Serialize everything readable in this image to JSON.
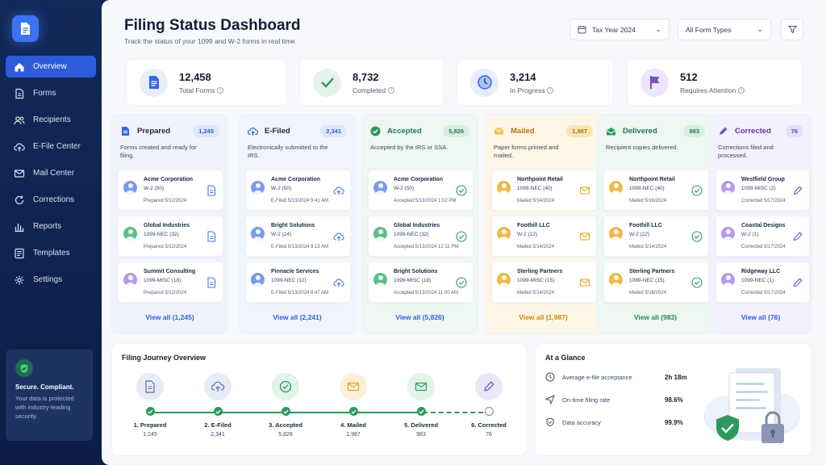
{
  "nav": {
    "items": [
      {
        "label": "Overview",
        "icon": "home-icon"
      },
      {
        "label": "Forms",
        "icon": "document-icon"
      },
      {
        "label": "Recipients",
        "icon": "users-icon"
      },
      {
        "label": "E-File Center",
        "icon": "cloud-upload-icon"
      },
      {
        "label": "Mail Center",
        "icon": "mail-icon"
      },
      {
        "label": "Corrections",
        "icon": "refresh-icon"
      },
      {
        "label": "Reports",
        "icon": "bar-chart-icon"
      },
      {
        "label": "Templates",
        "icon": "template-icon"
      },
      {
        "label": "Settings",
        "icon": "gear-icon"
      }
    ]
  },
  "secure": {
    "title": "Secure. Compliant.",
    "text": "Your data is protected with industry-leading security."
  },
  "header": {
    "title": "Filing Status Dashboard",
    "subtitle": "Track the status of your 1099 and W-2 forms in real time.",
    "tax_year": "Tax Year 2024",
    "form_types": "All Form Types"
  },
  "summary": [
    {
      "value": "12,458",
      "label": "Total Forms"
    },
    {
      "value": "8,732",
      "label": "Completed"
    },
    {
      "value": "3,214",
      "label": "In Progress"
    },
    {
      "value": "512",
      "label": "Requires Attention"
    }
  ],
  "columns": [
    {
      "title": "Prepared",
      "count": "1,245",
      "desc": "Forms created and ready for filing.",
      "view_all": "View all (1,245)",
      "accent": "#2f5fd8",
      "cards": [
        {
          "name": "Acme Corporation",
          "form": "W-2 (50)",
          "date": "Prepared 5/12/2024"
        },
        {
          "name": "Global Industries",
          "form": "1099-NEC (32)",
          "date": "Prepared 5/12/2024"
        },
        {
          "name": "Summit Consulting",
          "form": "1099-MISC (18)",
          "date": "Prepared 5/12/2024"
        }
      ]
    },
    {
      "title": "E-Filed",
      "count": "2,341",
      "desc": "Electronically submitted to the IRS.",
      "view_all": "View all (2,241)",
      "accent": "#2f5fd8",
      "cards": [
        {
          "name": "Acme Corporation",
          "form": "W-2 (50)",
          "date": "E-Filed 5/13/2024 9:41 AM"
        },
        {
          "name": "Bright Solutions",
          "form": "W-2 (24)",
          "date": "E-Filed 5/13/2024 9:15 AM"
        },
        {
          "name": "Pinnacle Services",
          "form": "1099-NEC (12)",
          "date": "E-Filed 5/13/2024 8:47 AM"
        }
      ]
    },
    {
      "title": "Accepted",
      "count": "5,826",
      "desc": "Accepted by the IRS or SSA.",
      "view_all": "View all (5,826)",
      "accent": "#27935a",
      "cards": [
        {
          "name": "Acme Corporation",
          "form": "W-2 (50)",
          "date": "Accepted 5/13/2024 1:02 PM"
        },
        {
          "name": "Global Industries",
          "form": "1099-NEC (32)",
          "date": "Accepted 5/13/2024 12:11 PM"
        },
        {
          "name": "Bright Solutions",
          "form": "1099-MISC (18)",
          "date": "Accepted 5/13/2024 11:00 AM"
        }
      ]
    },
    {
      "title": "Mailed",
      "count": "1,987",
      "desc": "Paper forms printed and mailed.",
      "view_all": "View all (1,987)",
      "accent": "#c98a0c",
      "cards": [
        {
          "name": "Northpoint Retail",
          "form": "1099-NEC (40)",
          "date": "Mailed 5/14/2024"
        },
        {
          "name": "Foothill LLC",
          "form": "W-2 (22)",
          "date": "Mailed 5/14/2024"
        },
        {
          "name": "Sterling Partners",
          "form": "1099-MISC (15)",
          "date": "Mailed 5/14/2024"
        }
      ]
    },
    {
      "title": "Delivered",
      "count": "983",
      "desc": "Recipient copies delivered.",
      "view_all": "View all (983)",
      "accent": "#1f8a58",
      "cards": [
        {
          "name": "Northpoint Retail",
          "form": "1099-NEC (40)",
          "date": "Mailed 5/16/2024"
        },
        {
          "name": "Foothill LLC",
          "form": "W-2 (22)",
          "date": "Mailed 5/14/2024"
        },
        {
          "name": "Sterling Partners",
          "form": "1099-NEC (15)",
          "date": "Mailed 5/16/2024"
        }
      ]
    },
    {
      "title": "Corrected",
      "count": "76",
      "desc": "Corrections filed and processed.",
      "view_all": "View all (76)",
      "accent": "#7b4fc9",
      "cards": [
        {
          "name": "Westfield Group",
          "form": "1099-MISC (2)",
          "date": "Corrected 5/17/2024"
        },
        {
          "name": "Coastal Designs",
          "form": "W-2 (1)",
          "date": "Corrected 5/17/2024"
        },
        {
          "name": "Ridgeway LLC",
          "form": "1099-NEC (1)",
          "date": "Corrected 5/17/2024"
        }
      ]
    }
  ],
  "journey": {
    "title": "Filing Journey Overview",
    "steps": [
      {
        "label": "1. Prepared",
        "count": "1,245"
      },
      {
        "label": "2. E-Filed",
        "count": "2,341"
      },
      {
        "label": "3. Accepted",
        "count": "5,826"
      },
      {
        "label": "4. Mailed",
        "count": "1,987"
      },
      {
        "label": "5. Delivered",
        "count": "983"
      },
      {
        "label": "6. Corrected",
        "count": "76"
      }
    ]
  },
  "glance": {
    "title": "At a Glance",
    "rows": [
      {
        "label": "Average e-file acceptance",
        "value": "2h 18m"
      },
      {
        "label": "On-time filing rate",
        "value": "98.6%"
      },
      {
        "label": "Data accuracy",
        "value": "99.9%"
      }
    ]
  }
}
